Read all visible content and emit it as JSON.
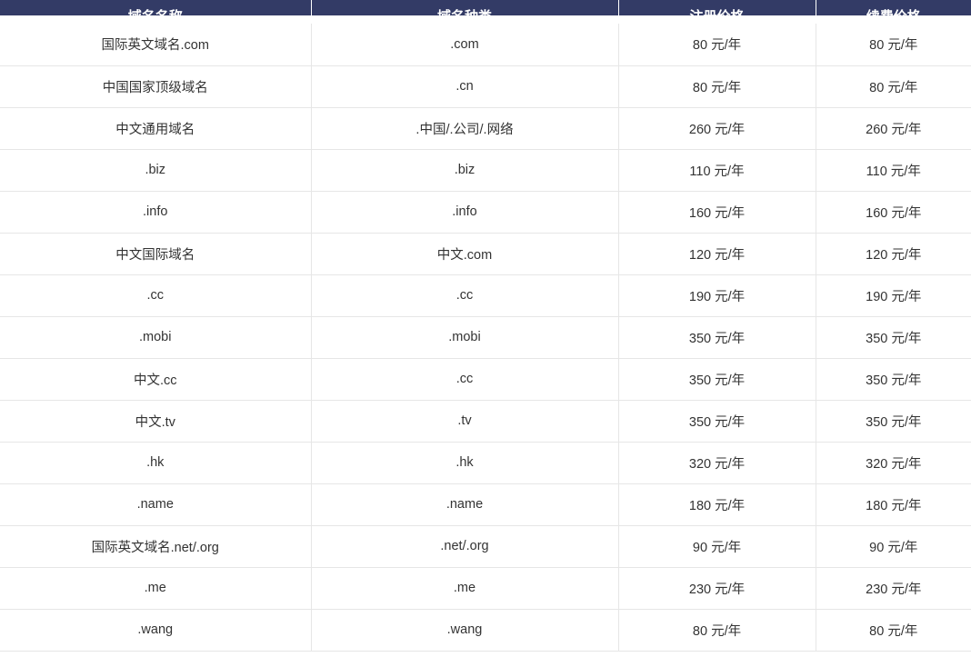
{
  "table": {
    "columns": [
      {
        "key": "name",
        "label": "域名名称"
      },
      {
        "key": "type",
        "label": "域名种类"
      },
      {
        "key": "reg_price",
        "label": "注册价格"
      },
      {
        "key": "renew_price",
        "label": "续费价格"
      }
    ],
    "rows": [
      {
        "name": "国际英文域名.com",
        "type": ".com",
        "reg_price": "80 元/年",
        "renew_price": "80 元/年"
      },
      {
        "name": "中国国家顶级域名",
        "type": ".cn",
        "reg_price": "80 元/年",
        "renew_price": "80 元/年"
      },
      {
        "name": "中文通用域名",
        "type": ".中国/.公司/.网络",
        "reg_price": "260 元/年",
        "renew_price": "260 元/年"
      },
      {
        "name": ".biz",
        "type": ".biz",
        "reg_price": "110 元/年",
        "renew_price": "110 元/年"
      },
      {
        "name": ".info",
        "type": ".info",
        "reg_price": "160 元/年",
        "renew_price": "160 元/年"
      },
      {
        "name": "中文国际域名",
        "type": "中文.com",
        "reg_price": "120 元/年",
        "renew_price": "120 元/年"
      },
      {
        "name": ".cc",
        "type": ".cc",
        "reg_price": "190 元/年",
        "renew_price": "190 元/年"
      },
      {
        "name": ".mobi",
        "type": ".mobi",
        "reg_price": "350 元/年",
        "renew_price": "350 元/年"
      },
      {
        "name": "中文.cc",
        "type": ".cc",
        "reg_price": "350 元/年",
        "renew_price": "350 元/年"
      },
      {
        "name": "中文.tv",
        "type": ".tv",
        "reg_price": "350 元/年",
        "renew_price": "350 元/年"
      },
      {
        "name": ".hk",
        "type": ".hk",
        "reg_price": "320 元/年",
        "renew_price": "320 元/年"
      },
      {
        "name": ".name",
        "type": ".name",
        "reg_price": "180 元/年",
        "renew_price": "180 元/年"
      },
      {
        "name": "国际英文域名.net/.org",
        "type": ".net/.org",
        "reg_price": "90 元/年",
        "renew_price": "90 元/年"
      },
      {
        "name": ".me",
        "type": ".me",
        "reg_price": "230 元/年",
        "renew_price": "230 元/年"
      },
      {
        "name": ".wang",
        "type": ".wang",
        "reg_price": "80 元/年",
        "renew_price": "80 元/年"
      }
    ]
  },
  "colors": {
    "header_background": "#333b66",
    "header_text": "#ffffff",
    "body_text": "#333333",
    "row_border": "#e6e6e6",
    "page_background": "#ffffff"
  }
}
